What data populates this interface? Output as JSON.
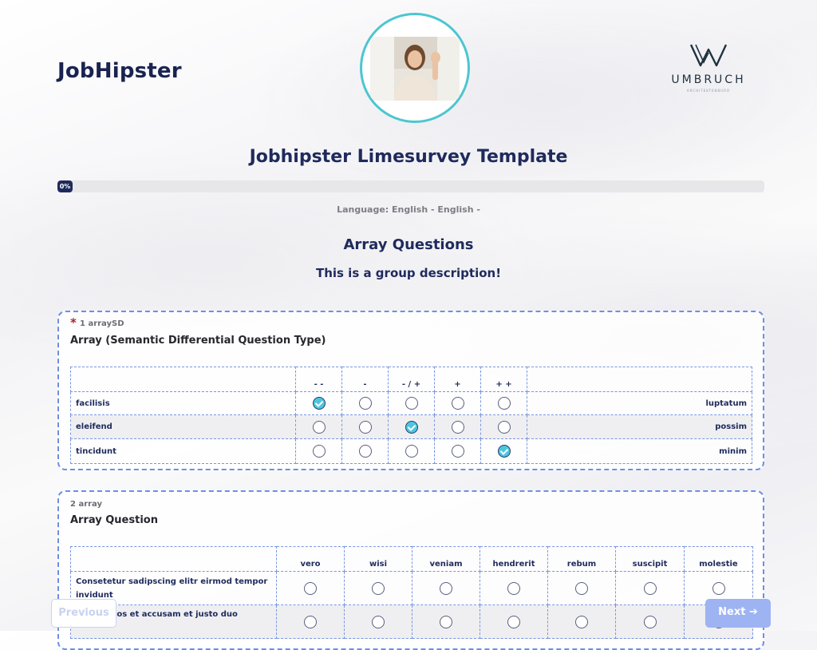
{
  "header": {
    "brand": "JobHipster",
    "logo": {
      "name": "UMBRUCH",
      "sub": "ARCHITEKTENBURO"
    }
  },
  "survey": {
    "title": "Jobhipster Limesurvey Template",
    "progress_label": "0%",
    "progress_value": 0,
    "language": "Language: English - English -"
  },
  "group": {
    "title": "Array Questions",
    "description": "This is a group description!"
  },
  "q1": {
    "mandatory_mark": "*",
    "code": "1 arraySD",
    "text": "Array (Semantic Differential Question Type)",
    "columns": [
      "- -",
      "-",
      "- / +",
      "+",
      "+ +"
    ],
    "rows": [
      {
        "left": "facilisis",
        "right": "luptatum",
        "selected": 0
      },
      {
        "left": "eleifend",
        "right": "possim",
        "selected": 2
      },
      {
        "left": "tincidunt",
        "right": "minim",
        "selected": 4
      }
    ]
  },
  "q2": {
    "code": "2 array",
    "text": "Array Question",
    "columns": [
      "vero",
      "wisi",
      "veniam",
      "hendrerit",
      "rebum",
      "suscipit",
      "molestie"
    ],
    "rows": [
      {
        "label": "Consetetur sadipscing elitr eirmod tempor invidunt"
      },
      {
        "label": "At vero eos et accusam et justo duo"
      }
    ]
  },
  "nav": {
    "previous": "Previous",
    "next": "Next ➔"
  },
  "colors": {
    "primary": "#1f2a5c",
    "accent": "#4cc6e0",
    "border": "#6f8ee6",
    "next_button": "#9db3f2"
  }
}
